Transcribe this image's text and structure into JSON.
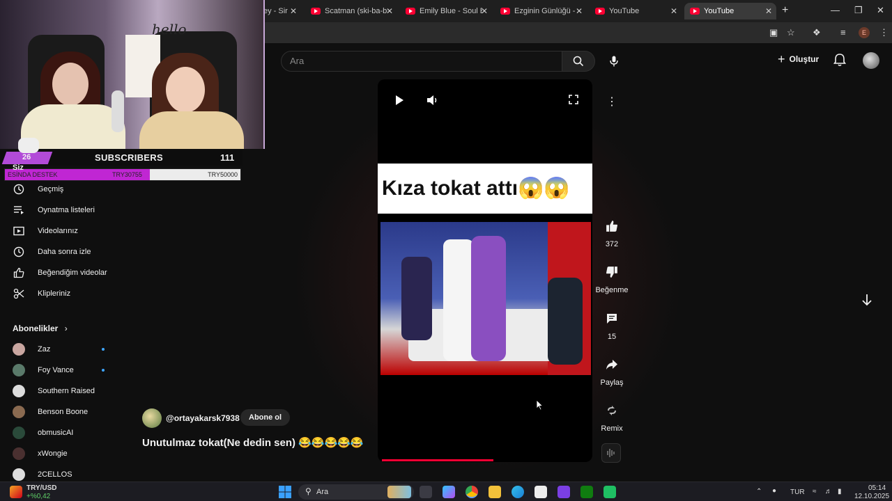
{
  "browser": {
    "tabs": [
      {
        "title": "ey - Sir",
        "active": false
      },
      {
        "title": "Scatman (ski-ba-bop",
        "active": false
      },
      {
        "title": "Emily Blue - Soul Blue",
        "active": false
      },
      {
        "title": "Ezginin Günlüğü - El",
        "active": false
      },
      {
        "title": "YouTube",
        "active": false
      },
      {
        "title": "YouTube",
        "active": true
      }
    ],
    "close_glyph": "✕",
    "new_tab_glyph": "+",
    "profile_letter": "E"
  },
  "header": {
    "search_placeholder": "Ara",
    "create_label": "Oluştur"
  },
  "sidebar": {
    "you_label": "Siz",
    "items": [
      {
        "label": "Geçmiş",
        "icon": "history-icon"
      },
      {
        "label": "Oynatma listeleri",
        "icon": "playlists-icon"
      },
      {
        "label": "Videolarınız",
        "icon": "your-videos-icon"
      },
      {
        "label": "Daha sonra izle",
        "icon": "watch-later-icon"
      },
      {
        "label": "Beğendiğim videolar",
        "icon": "liked-icon"
      },
      {
        "label": "Klipleriniz",
        "icon": "clips-icon"
      }
    ],
    "subscriptions_title": "Abonelikler",
    "subscriptions": [
      {
        "name": "Zaz",
        "new": true,
        "color": "#c9a6a0"
      },
      {
        "name": "Foy Vance",
        "new": true,
        "color": "#5a7a6a"
      },
      {
        "name": "Southern Raised",
        "new": false,
        "color": "#dcdcdc"
      },
      {
        "name": "Benson Boone",
        "new": false,
        "color": "#8a6a50"
      },
      {
        "name": "obmusicAI",
        "new": false,
        "color": "#2a4a3a"
      },
      {
        "name": "xWongie",
        "new": false,
        "color": "#4a3030"
      },
      {
        "name": "2CELLOS",
        "new": false,
        "color": "#dddddd"
      }
    ]
  },
  "short": {
    "caption": "Kıza tokat attı😱😱",
    "progress": 0.54,
    "channel": "@ortayakarsk7938",
    "subscribe_label": "Abone ol",
    "title": "Unutulmaz tokat(Ne dedin sen) 😂😂😂😂😂",
    "likes": "372",
    "dislike_label": "Beğenme",
    "comments": "15",
    "share_label": "Paylaş",
    "remix_label": "Remix"
  },
  "overlay": {
    "hello_text": "hello",
    "sub_number": "26",
    "sub_label": "SUBSCRIBERS",
    "sub_count": "111",
    "goal_left": "ESİNDA DESTEK",
    "goal_mid": "TRY30755",
    "goal_right": "TRY50000",
    "goal_fill": 0.615,
    "accent": "#b24bd8"
  },
  "taskbar": {
    "ticker_name": "TRY/USD",
    "ticker_change": "+%0,42",
    "search_label": "Ara",
    "lang": "TUR",
    "time": "05:14",
    "date": "12.10.2025"
  }
}
